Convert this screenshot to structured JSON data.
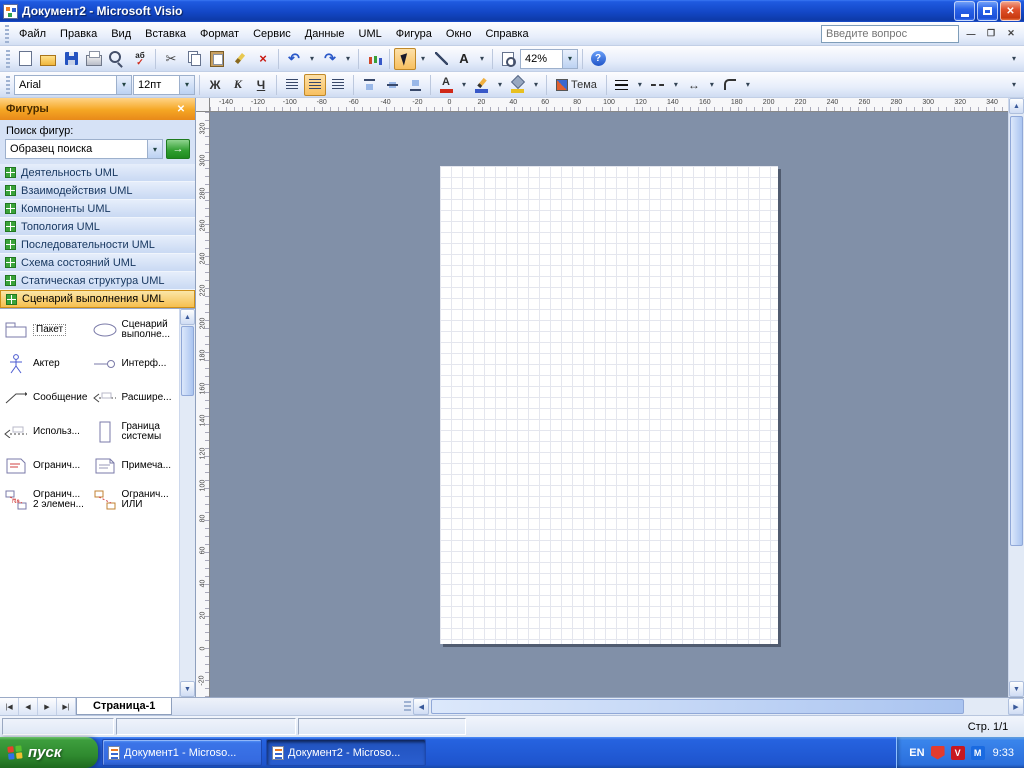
{
  "window": {
    "title": "Документ2 - Microsoft Visio"
  },
  "menu": {
    "items": [
      {
        "label": "Файл"
      },
      {
        "label": "Правка"
      },
      {
        "label": "Вид"
      },
      {
        "label": "Вставка"
      },
      {
        "label": "Формат"
      },
      {
        "label": "Сервис"
      },
      {
        "label": "Данные"
      },
      {
        "label": "UML"
      },
      {
        "label": "Фигура"
      },
      {
        "label": "Окно"
      },
      {
        "label": "Справка"
      }
    ],
    "question_placeholder": "Введите вопрос"
  },
  "icons": {
    "cut": "✂",
    "undo": "↶",
    "redo": "↷",
    "delete": "×",
    "text_tool": "A",
    "help": "?",
    "caret": "▾",
    "overflow": "▾",
    "go": "→",
    "spelling": "аб",
    "check": "✓",
    "font_color_letter": "А",
    "line_ends": "↔",
    "doc_min": "—",
    "doc_restore": "❐",
    "doc_close": "✕",
    "close": "✕",
    "nav_first": "|◀",
    "nav_prev": "◀",
    "nav_next": "▶",
    "nav_last": "▶|",
    "scroll_up": "▲",
    "scroll_down": "▼",
    "scroll_left": "◀",
    "scroll_right": "▶"
  },
  "standard_toolbar": {
    "zoom_value": "42%"
  },
  "formatting_toolbar": {
    "font": "Arial",
    "size": "12пт",
    "bold": "Ж",
    "italic": "К",
    "underline": "Ч",
    "theme": "Тема"
  },
  "shapes_panel": {
    "title": "Фигуры",
    "search_label": "Поиск фигур:",
    "search_value": "Образец поиска",
    "stencils": [
      {
        "label": "Деятельность UML"
      },
      {
        "label": "Взаимодействия UML"
      },
      {
        "label": "Компоненты UML"
      },
      {
        "label": "Топология UML"
      },
      {
        "label": "Последовательности UML"
      },
      {
        "label": "Схема состояний UML"
      },
      {
        "label": "Статическая структура UML"
      },
      {
        "label": "Сценарий выполнения UML",
        "selected": true
      }
    ],
    "shapes": [
      {
        "label": "Пакет"
      },
      {
        "label": "Сценарий выполне..."
      },
      {
        "label": "Актер"
      },
      {
        "label": "Интерф..."
      },
      {
        "label": "Сообщение"
      },
      {
        "label": "Расшире..."
      },
      {
        "label": "Использ..."
      },
      {
        "label": "Граница системы"
      },
      {
        "label": "Огранич..."
      },
      {
        "label": "Примеча..."
      },
      {
        "label": "Огранич... 2 элемен..."
      },
      {
        "label": "Огранич... ИЛИ"
      }
    ]
  },
  "ruler": {
    "horizontal": [
      "-140",
      "-120",
      "-100",
      "-80",
      "-60",
      "-40",
      "-20",
      "0",
      "20",
      "40",
      "60",
      "80",
      "100",
      "120",
      "140",
      "160",
      "180",
      "200",
      "220",
      "240",
      "260",
      "280",
      "300",
      "320",
      "340"
    ],
    "vertical": [
      "320",
      "300",
      "280",
      "260",
      "240",
      "220",
      "200",
      "180",
      "160",
      "140",
      "120",
      "100",
      "80",
      "60",
      "40",
      "20",
      "0",
      "-20"
    ]
  },
  "page_tabs": {
    "tab_label": "Страница-1"
  },
  "status_bar": {
    "page_indicator": "Стр. 1/1"
  },
  "taskbar": {
    "start_label": "пуск",
    "tasks": [
      {
        "label": "Документ1 - Microso..."
      },
      {
        "label": "Документ2 - Microso...",
        "active": true
      }
    ],
    "tray": {
      "language": "EN",
      "time": "9:33"
    }
  }
}
